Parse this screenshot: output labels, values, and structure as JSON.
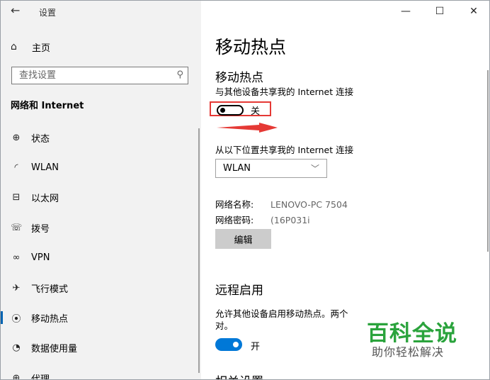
{
  "window": {
    "title": "设置",
    "controls": {
      "minimize": "—",
      "maximize": "☐",
      "close": "✕"
    }
  },
  "sidebar": {
    "home_label": "主页",
    "search_placeholder": "查找设置",
    "section_title": "网络和 Internet",
    "items": [
      {
        "label": "状态",
        "icon": "globe-icon"
      },
      {
        "label": "WLAN",
        "icon": "wifi-icon"
      },
      {
        "label": "以太网",
        "icon": "ethernet-icon"
      },
      {
        "label": "拨号",
        "icon": "dialup-icon"
      },
      {
        "label": "VPN",
        "icon": "vpn-icon"
      },
      {
        "label": "飞行模式",
        "icon": "airplane-icon"
      },
      {
        "label": "移动热点",
        "icon": "hotspot-icon",
        "active": true
      },
      {
        "label": "数据使用量",
        "icon": "data-usage-icon"
      },
      {
        "label": "代理",
        "icon": "globe-icon"
      }
    ]
  },
  "main": {
    "page_title": "移动热点",
    "hotspot": {
      "title": "移动热点",
      "description": "与其他设备共享我的 Internet 连接",
      "toggle_state": "关",
      "toggle_on": false
    },
    "share_from": {
      "label": "从以下位置共享我的 Internet 连接",
      "selected": "WLAN"
    },
    "network": {
      "name_label": "网络名称:",
      "name_value": "LENOVO-PC 7504",
      "password_label": "网络密码:",
      "password_value": "(16P031i",
      "edit_button": "编辑"
    },
    "remote": {
      "title": "远程启用",
      "description": "允许其他设备启用移动热点。两个 对。",
      "toggle_state": "开",
      "toggle_on": true
    },
    "related_heading": "相关设置"
  },
  "watermark": {
    "title": "百科全说",
    "subtitle": "助你轻松解决"
  },
  "colors": {
    "accent": "#0078d7",
    "highlight_box": "#e53935",
    "watermark": "#2aa33c"
  }
}
